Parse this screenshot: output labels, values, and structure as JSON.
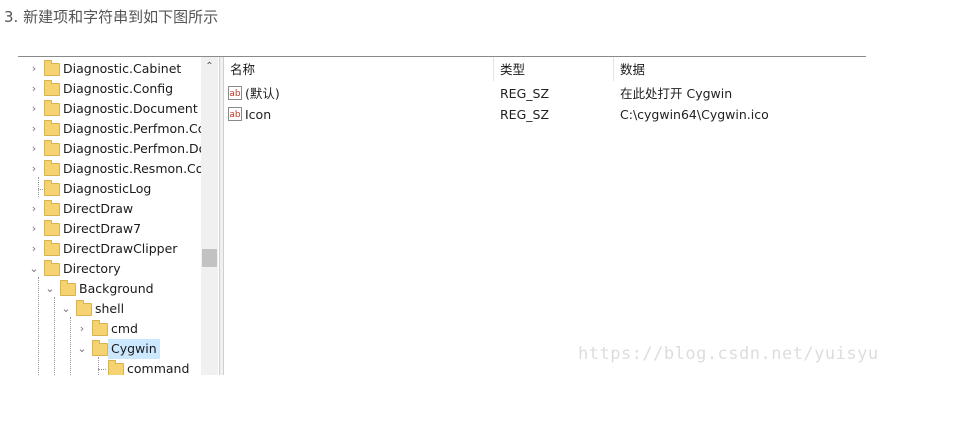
{
  "heading": "3. 新建项和字符串到如下图所示",
  "tree": {
    "items": [
      {
        "label": "Diagnostic.Cabinet",
        "chevron": "›",
        "selected": false
      },
      {
        "label": "Diagnostic.Config",
        "chevron": "›",
        "selected": false
      },
      {
        "label": "Diagnostic.Document",
        "chevron": "›",
        "selected": false
      },
      {
        "label": "Diagnostic.Perfmon.Cor",
        "chevron": "›",
        "selected": false
      },
      {
        "label": "Diagnostic.Perfmon.Doc",
        "chevron": "›",
        "selected": false
      },
      {
        "label": "Diagnostic.Resmon.Con",
        "chevron": "›",
        "selected": false
      },
      {
        "label": "DiagnosticLog",
        "chevron": "",
        "selected": false
      },
      {
        "label": "DirectDraw",
        "chevron": "›",
        "selected": false
      },
      {
        "label": "DirectDraw7",
        "chevron": "›",
        "selected": false
      },
      {
        "label": "DirectDrawClipper",
        "chevron": "›",
        "selected": false
      },
      {
        "label": "Directory",
        "chevron": "⌄",
        "selected": false
      },
      {
        "label": "Background",
        "chevron": "⌄",
        "selected": false
      },
      {
        "label": "shell",
        "chevron": "⌄",
        "selected": false
      },
      {
        "label": "cmd",
        "chevron": "›",
        "selected": false
      },
      {
        "label": "Cygwin",
        "chevron": "⌄",
        "selected": true
      },
      {
        "label": "command",
        "chevron": "",
        "selected": false
      }
    ]
  },
  "scrollbar": {
    "up_arrow": "⌃"
  },
  "list": {
    "columns": {
      "name": "名称",
      "type": "类型",
      "data": "数据"
    },
    "rows": [
      {
        "icon": "ab",
        "name": "(默认)",
        "type": "REG_SZ",
        "data": "在此处打开 Cygwin"
      },
      {
        "icon": "ab",
        "name": "Icon",
        "type": "REG_SZ",
        "data": "C:\\cygwin64\\Cygwin.ico"
      }
    ]
  },
  "watermark": "https://blog.csdn.net/yuisyu"
}
